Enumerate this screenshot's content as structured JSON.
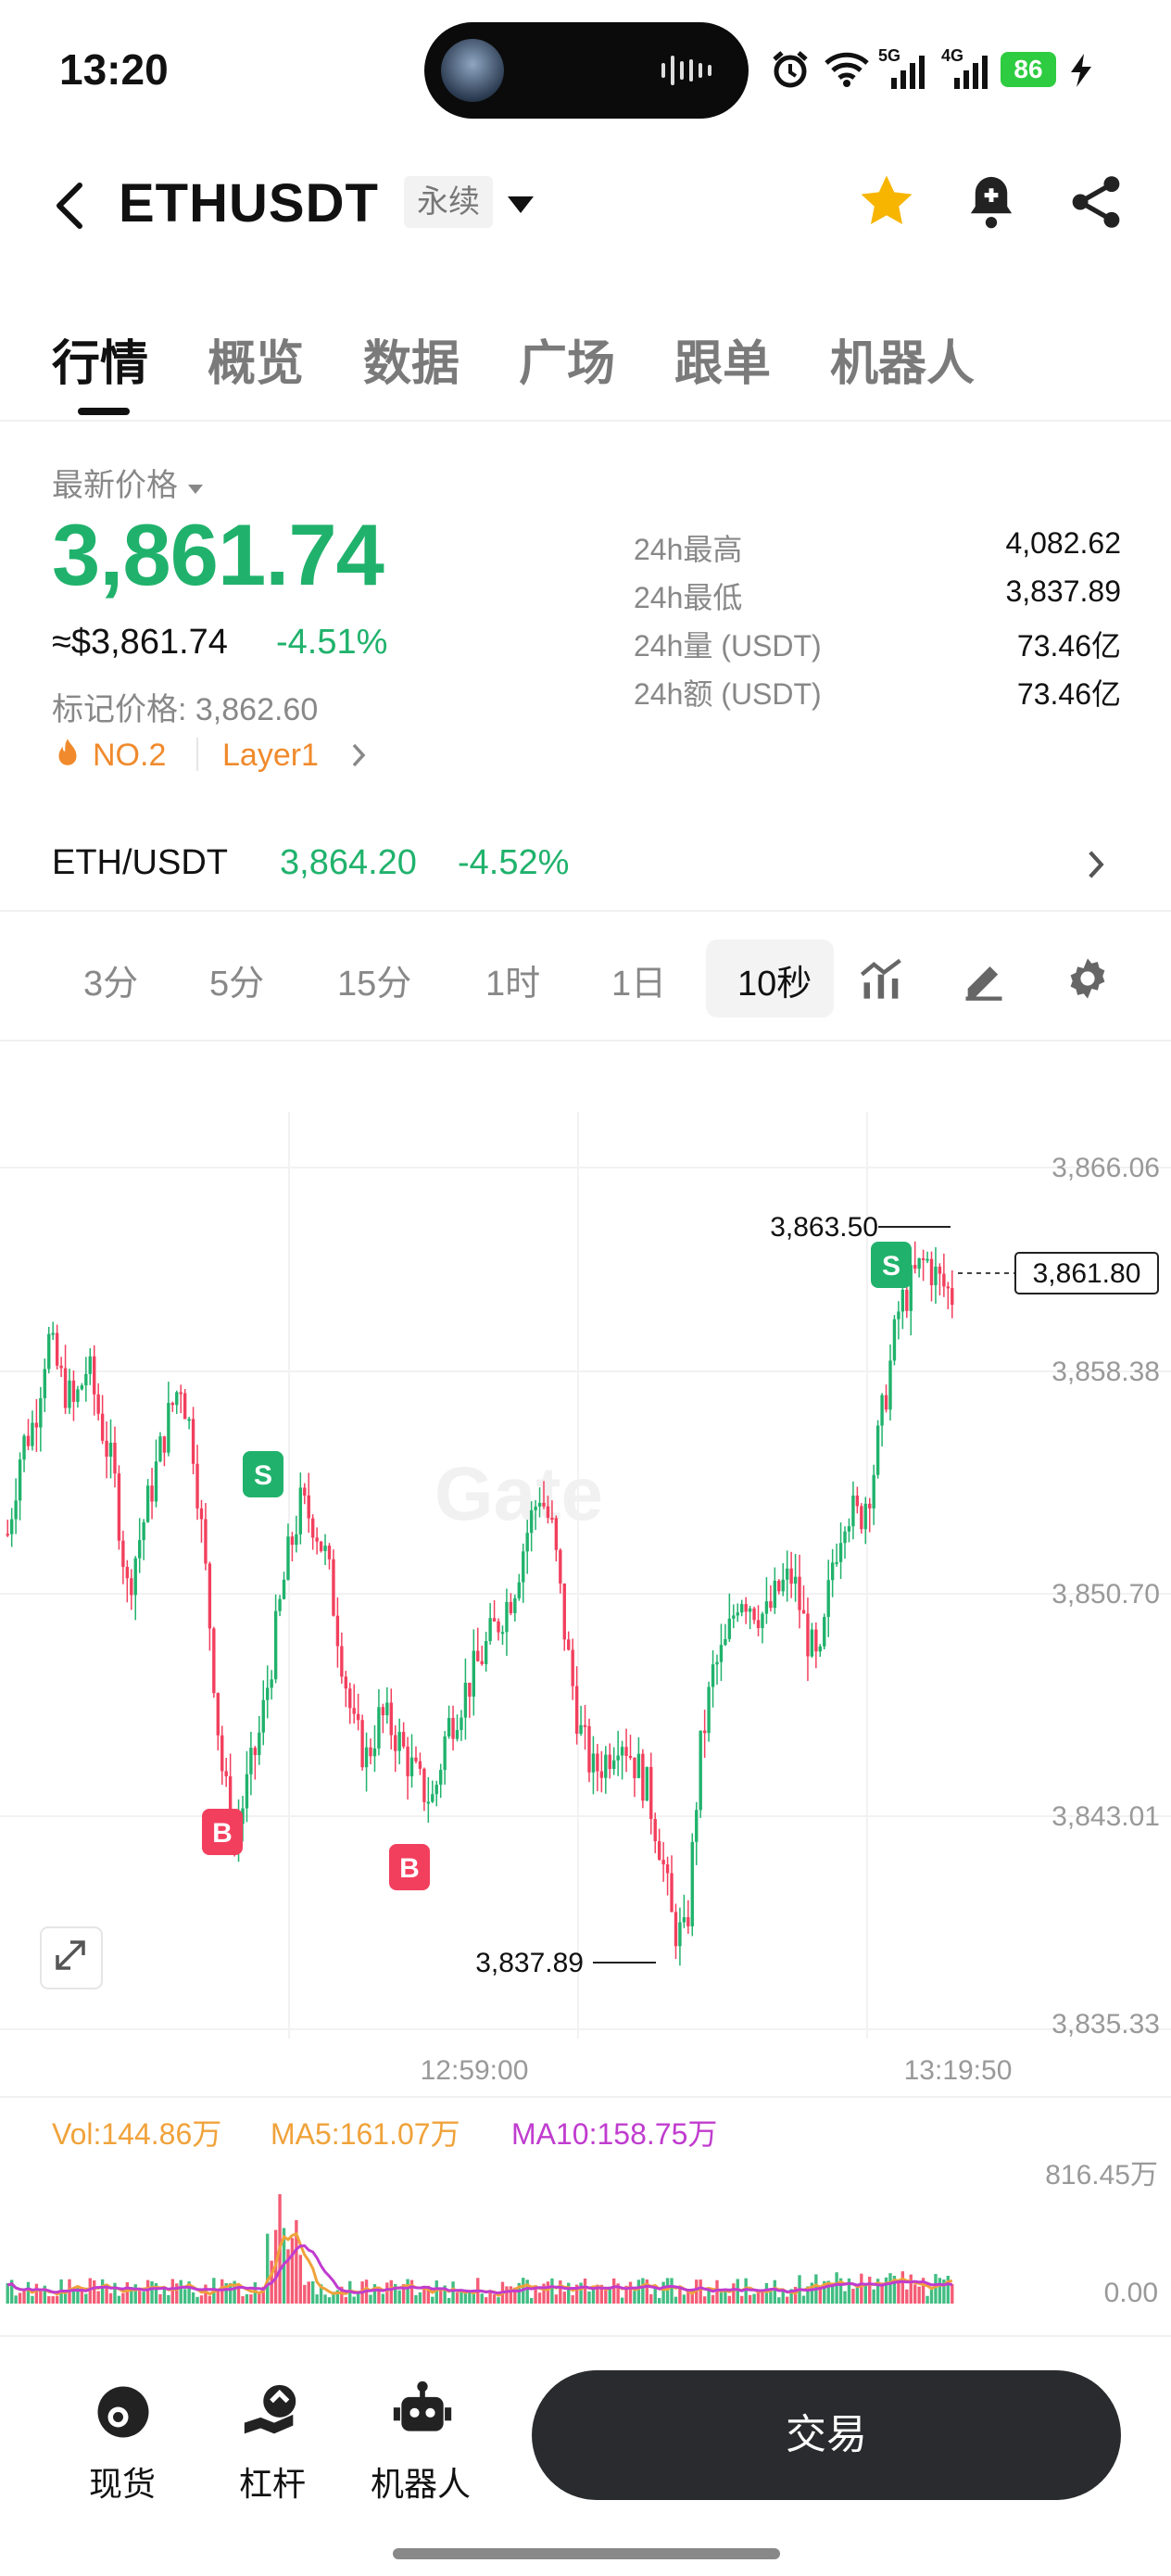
{
  "status_bar": {
    "time": "13:20",
    "battery": "86",
    "net1": "5G",
    "net2": "4G"
  },
  "header": {
    "symbol": "ETHUSDT",
    "contract_type": "永续"
  },
  "tabs": [
    "行情",
    "概览",
    "数据",
    "广场",
    "跟单",
    "机器人"
  ],
  "price": {
    "latest_label": "最新价格",
    "last": "3,861.74",
    "usd": "≈$3,861.74",
    "change_pct": "-4.51%",
    "mark_label": "标记价格: 3,862.60",
    "rank": "NO.2",
    "category": "Layer1",
    "stats": [
      {
        "label": "24h最高",
        "value": "4,082.62"
      },
      {
        "label": "24h最低",
        "value": "3,837.89"
      },
      {
        "label": "24h量 (USDT)",
        "value": "73.46亿"
      },
      {
        "label": "24h额 (USDT)",
        "value": "73.46亿"
      }
    ],
    "color_up": "#20b26c",
    "color_down": "#f23f5d"
  },
  "spot": {
    "pair": "ETH/USDT",
    "price": "3,864.20",
    "change": "-4.52%"
  },
  "intervals": {
    "options": [
      "3分",
      "5分",
      "15分",
      "1时",
      "1日",
      "10秒"
    ],
    "selected": "10秒"
  },
  "chart_data": {
    "type": "candlestick",
    "watermark": "Gate",
    "y_ticks": [
      "3,866.06",
      "3,858.38",
      "3,850.70",
      "3,843.01",
      "3,835.33"
    ],
    "y_range": [
      3835.33,
      3866.06
    ],
    "x_ticks": [
      "12:59:00",
      "13:19:50"
    ],
    "current_price_label": "3,861.80",
    "high_label": "3,863.50",
    "low_label": "3,837.89",
    "markers": [
      "S",
      "B",
      "B",
      "S"
    ],
    "close_path": [
      3853,
      3856,
      3857,
      3860,
      3858.5,
      3857.5,
      3859,
      3857,
      3855,
      3851,
      3853,
      3855,
      3857,
      3858.5,
      3856,
      3851,
      3845,
      3842,
      3844,
      3846,
      3849,
      3852,
      3854,
      3853.5,
      3852,
      3849,
      3846,
      3845,
      3846.5,
      3846,
      3845,
      3844,
      3843.5,
      3846,
      3847,
      3848,
      3849,
      3850,
      3851,
      3853,
      3854.5,
      3853,
      3849,
      3846,
      3844.5,
      3845,
      3846,
      3845,
      3844,
      3842,
      3839,
      3838.5,
      3845,
      3848,
      3849,
      3851,
      3850.5,
      3850,
      3851,
      3851.5,
      3849.5,
      3848,
      3852,
      3854,
      3853.5,
      3855,
      3858,
      3861,
      3862,
      3862.8,
      3862,
      3861.5
    ],
    "volume": {
      "vol_label": "Vol:144.86万",
      "ma5_label": "MA5:161.07万",
      "ma10_label": "MA10:158.75万",
      "y_max_label": "816.45万",
      "y_min_label": "0.00",
      "ma5_color": "#f0a23a",
      "ma10_color": "#c03ccf"
    }
  },
  "bottom_nav": {
    "items": [
      "现货",
      "杠杆",
      "机器人"
    ],
    "trade_label": "交易"
  }
}
